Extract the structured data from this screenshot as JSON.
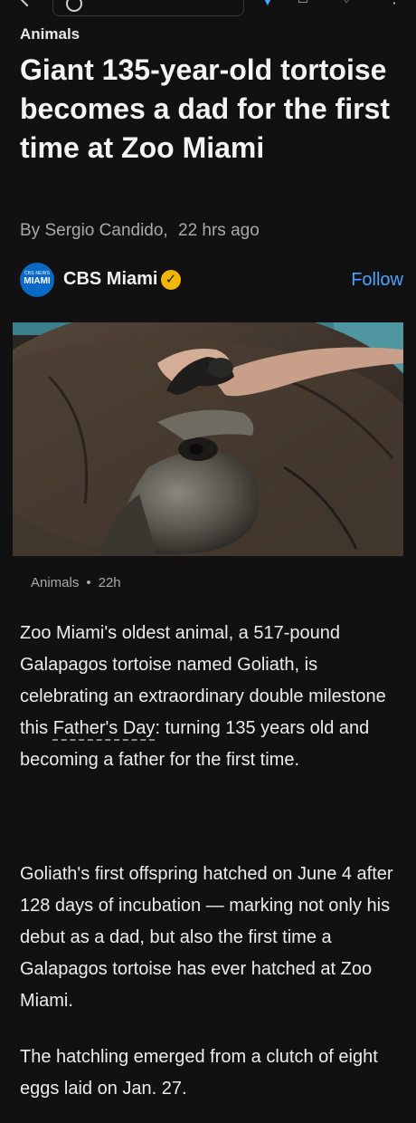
{
  "toolbar": {
    "back_icon": "back-arrow-icon",
    "search_icon": "search-icon",
    "download_icon": "download-icon",
    "bookmark_icon": "bookmark-icon",
    "like_icon": "like-icon",
    "more_icon": "more-options-icon"
  },
  "article": {
    "category": "Animals",
    "title": "Giant 135-year-old tortoise becomes a dad for the first time at Zoo Miami",
    "author": "By Sergio Candido,",
    "time_ago": "22 hrs ago",
    "source": {
      "logo_small": "CBS NEWS",
      "logo_main": "MIAMI",
      "name": "CBS Miami",
      "verified_icon": "verified-badge-icon",
      "follow_label": "Follow"
    },
    "image_meta": {
      "category": "Animals",
      "time": "22h"
    },
    "paragraph1_before": "Zoo Miami's oldest animal, a 517-pound Galapagos tortoise named Goliath, is celebrating an extraordinary double milestone this ",
    "paragraph1_link": "Father's Day",
    "paragraph1_after": ": turning 135 years old and becoming a father for the first time.",
    "paragraph2": "Goliath's first offspring hatched on June 4 after 128 days of incubation — marking not only his debut as a dad, but also the first time a Galapagos tortoise has ever hatched at Zoo Miami.",
    "paragraph3": "The hatchling emerged from a clutch of eight eggs laid on Jan. 27."
  },
  "colors": {
    "background": "#111111",
    "accent": "#4aa3ff",
    "verified": "#f2b705",
    "logo": "#0a69c7"
  }
}
